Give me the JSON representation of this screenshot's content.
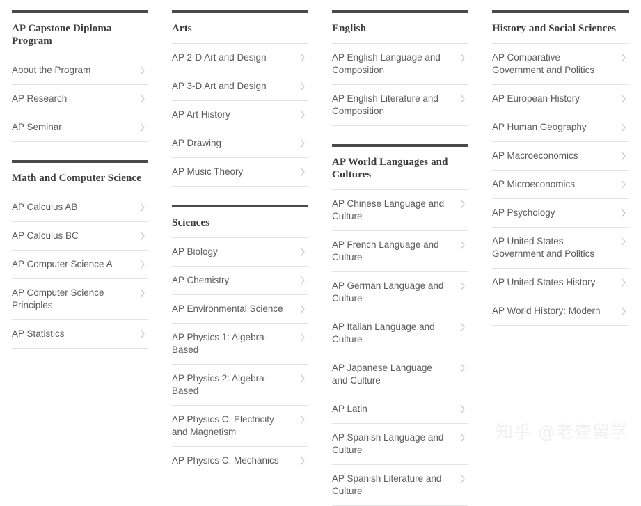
{
  "watermark": {
    "text": "知乎 @老查留学"
  },
  "icons": {
    "chevron": "chevron-right-icon"
  },
  "colors": {
    "section_rule": "#494949",
    "heading_text": "#3c3c3c",
    "item_text": "#5b5b5b",
    "separator": "#e4e4e4",
    "chevron": "#c7c7c7",
    "background": "#ffffff",
    "watermark": "#efefef"
  },
  "columns": [
    {
      "id": "column-1",
      "sections": [
        {
          "id": "ap-capstone-diploma-program",
          "heading": "AP Capstone Diploma Program",
          "items": [
            "About the Program",
            "AP Research",
            "AP Seminar"
          ]
        },
        {
          "id": "math-and-computer-science",
          "heading": "Math and Computer Science",
          "items": [
            "AP Calculus AB",
            "AP Calculus BC",
            "AP Computer Science A",
            "AP Computer Science Principles",
            "AP Statistics"
          ]
        }
      ]
    },
    {
      "id": "column-2",
      "sections": [
        {
          "id": "arts",
          "heading": "Arts",
          "items": [
            "AP 2-D Art and Design",
            "AP 3-D Art and Design",
            "AP Art History",
            "AP Drawing",
            "AP Music Theory"
          ]
        },
        {
          "id": "sciences",
          "heading": "Sciences",
          "items": [
            "AP Biology",
            "AP Chemistry",
            "AP Environmental Science",
            "AP Physics 1: Algebra-Based",
            "AP Physics 2: Algebra-Based",
            "AP Physics C: Electricity and Magnetism",
            "AP Physics C: Mechanics"
          ]
        }
      ]
    },
    {
      "id": "column-3",
      "sections": [
        {
          "id": "english",
          "heading": "English",
          "items": [
            "AP English Language and Composition",
            "AP English Literature and Composition"
          ]
        },
        {
          "id": "ap-world-languages-and-cultures",
          "heading": "AP World Languages and Cultures",
          "items": [
            "AP Chinese Language and Culture",
            "AP French Language and Culture",
            "AP German Language and Culture",
            "AP Italian Language and Culture",
            "AP Japanese Language and Culture",
            "AP Latin",
            "AP Spanish Language and Culture",
            "AP Spanish Literature and Culture"
          ]
        }
      ]
    },
    {
      "id": "column-4",
      "sections": [
        {
          "id": "history-and-social-sciences",
          "heading": "History and Social Sciences",
          "items": [
            "AP Comparative Government and Politics",
            "AP European History",
            "AP Human Geography",
            "AP Macroeconomics",
            "AP Microeconomics",
            "AP Psychology",
            "AP United States Government and Politics",
            "AP United States History",
            "AP World History: Modern"
          ]
        }
      ]
    }
  ]
}
